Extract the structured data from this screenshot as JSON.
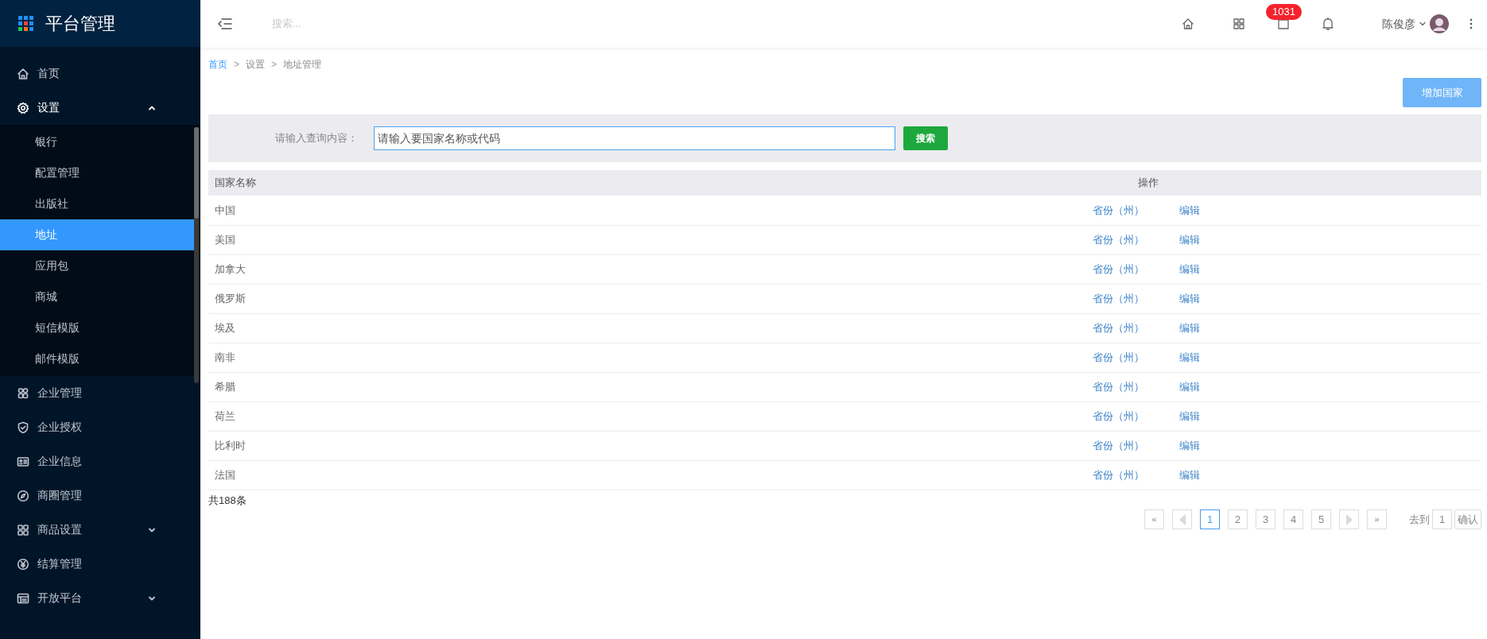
{
  "sidebar": {
    "title": "平台管理",
    "items": [
      {
        "label": "首页"
      },
      {
        "label": "设置",
        "expanded": true,
        "children": [
          {
            "label": "银行",
            "selected": false
          },
          {
            "label": "配置管理",
            "selected": false
          },
          {
            "label": "出版社",
            "selected": false
          },
          {
            "label": "地址",
            "selected": true
          },
          {
            "label": "应用包",
            "selected": false
          },
          {
            "label": "商城",
            "selected": false
          },
          {
            "label": "短信模版",
            "selected": false
          },
          {
            "label": "邮件模版",
            "selected": false
          }
        ]
      },
      {
        "label": "企业管理"
      },
      {
        "label": "企业授权"
      },
      {
        "label": "企业信息"
      },
      {
        "label": "商圈管理"
      },
      {
        "label": "商品设置",
        "expanded": false
      },
      {
        "label": "结算管理"
      },
      {
        "label": "开放平台",
        "expanded": false
      }
    ]
  },
  "header": {
    "search_placeholder": "搜索...",
    "badge": "1031",
    "user": "陈俊彦"
  },
  "breadcrumb": [
    {
      "label": "首页",
      "link": true
    },
    {
      "separator": ">",
      "label": "设置",
      "link": false
    },
    {
      "separator": ">",
      "label": "地址管理",
      "link": false
    }
  ],
  "add_button": "增加国家",
  "query": {
    "label": "请输入查询内容：",
    "placeholder": "请输入要国家名称或代码",
    "button": "搜索"
  },
  "table": {
    "columns": [
      "国家名称",
      "操作"
    ],
    "rows": [
      {
        "name": "中国",
        "actions": [
          "省份（州）",
          "编辑"
        ]
      },
      {
        "name": "美国",
        "actions": [
          "省份（州）",
          "编辑"
        ]
      },
      {
        "name": "加拿大",
        "actions": [
          "省份（州）",
          "编辑"
        ]
      },
      {
        "name": "俄罗斯",
        "actions": [
          "省份（州）",
          "编辑"
        ]
      },
      {
        "name": "埃及",
        "actions": [
          "省份（州）",
          "编辑"
        ]
      },
      {
        "name": "南非",
        "actions": [
          "省份（州）",
          "编辑"
        ]
      },
      {
        "name": "希腊",
        "actions": [
          "省份（州）",
          "编辑"
        ]
      },
      {
        "name": "荷兰",
        "actions": [
          "省份（州）",
          "编辑"
        ]
      },
      {
        "name": "比利时",
        "actions": [
          "省份（州）",
          "编辑"
        ]
      },
      {
        "name": "法国",
        "actions": [
          "省份（州）",
          "编辑"
        ]
      }
    ]
  },
  "total": "共188条",
  "pagination": {
    "first": "«",
    "last": "»",
    "pages": [
      {
        "label": "1",
        "selected": true
      },
      {
        "label": "2",
        "selected": false
      },
      {
        "label": "3",
        "selected": false
      },
      {
        "label": "4",
        "selected": false
      },
      {
        "label": "5",
        "selected": false
      }
    ],
    "goto_label": "去到",
    "goto_value": "1",
    "confirm": "确认"
  }
}
